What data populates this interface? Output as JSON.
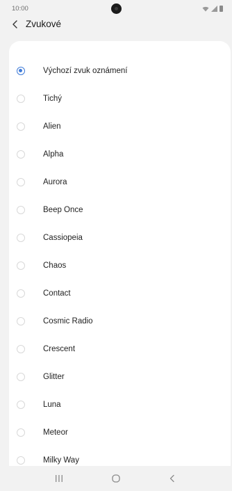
{
  "status_bar": {
    "time": "10:00"
  },
  "header": {
    "title": "Zvukové"
  },
  "sounds": {
    "selected_index": 0,
    "items": [
      {
        "label": "Výchozí zvuk oznámení"
      },
      {
        "label": "Tichý"
      },
      {
        "label": "Alien"
      },
      {
        "label": "Alpha"
      },
      {
        "label": "Aurora"
      },
      {
        "label": "Beep Once"
      },
      {
        "label": "Cassiopeia"
      },
      {
        "label": "Chaos"
      },
      {
        "label": "Contact"
      },
      {
        "label": "Cosmic Radio"
      },
      {
        "label": "Crescent"
      },
      {
        "label": "Glitter"
      },
      {
        "label": "Luna"
      },
      {
        "label": "Meteor"
      },
      {
        "label": "Milky Way"
      }
    ]
  },
  "colors": {
    "accent": "#3f7bd8",
    "background": "#f2f2f2",
    "card": "#ffffff"
  },
  "icons": {
    "back": "chevron-left-icon",
    "recents": "recents-icon",
    "home": "home-icon",
    "nav_back": "back-icon"
  }
}
